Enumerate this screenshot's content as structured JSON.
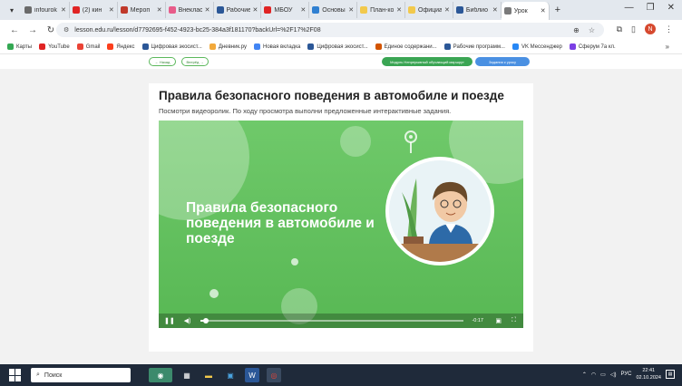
{
  "tabs": [
    {
      "label": "infourok",
      "color": "#6a6a6a"
    },
    {
      "label": "(2) кин",
      "color": "#e02424"
    },
    {
      "label": "Мероп",
      "color": "#c0392b"
    },
    {
      "label": "Внеклас",
      "color": "#e85c8a"
    },
    {
      "label": "Рабочие",
      "color": "#2b5797"
    },
    {
      "label": "МБОУ",
      "color": "#e02424"
    },
    {
      "label": "Основы",
      "color": "#2f7fd1"
    },
    {
      "label": "План-ко",
      "color": "#f2c94c"
    },
    {
      "label": "Официа",
      "color": "#f2c94c"
    },
    {
      "label": "Библио",
      "color": "#2b5797"
    },
    {
      "label": "Урок",
      "color": "#7a7a7a",
      "active": true
    }
  ],
  "address": {
    "url": "lesson.edu.ru/lesson/d7792695-f452-4923-bc25-384a3f181170?backUrl=%2F17%2F08"
  },
  "bookmarks": [
    {
      "label": "Карты",
      "color": "#34a853"
    },
    {
      "label": "YouTube",
      "color": "#e02424"
    },
    {
      "label": "Gmail",
      "color": "#ea4335"
    },
    {
      "label": "Яндекс",
      "color": "#fc3f1d"
    },
    {
      "label": "Цифровая экосист...",
      "color": "#2b5797"
    },
    {
      "label": "Дневник.ру",
      "color": "#f2a93b"
    },
    {
      "label": "Новая вкладка",
      "color": "#4285f4"
    },
    {
      "label": "Цифровая экосист...",
      "color": "#2b5797"
    },
    {
      "label": "Единое содержани...",
      "color": "#d35400"
    },
    {
      "label": "Рабочие программ...",
      "color": "#2b5797"
    },
    {
      "label": "VK Мессенджер",
      "color": "#2787f5"
    },
    {
      "label": "Сферум 7а кл.",
      "color": "#7b3fe4"
    }
  ],
  "lesson_toolbar": {
    "back": "← Назад",
    "forward": "Вперёд →",
    "green_button": "Модуль Непрерывный обучающий маршрут",
    "blue_button": "Задания к уроку"
  },
  "card": {
    "title": "Правила безопасного поведения в автомобиле и поезде",
    "subtitle": "Посмотри видеоролик. По ходу просмотра выполни предложенные интерактивные задания."
  },
  "video": {
    "title": "Правила безопасного поведения в автомобиле и поезде",
    "time": "-0:17",
    "progress": 0.02
  },
  "taskbar": {
    "search_label": "Поиск",
    "lang": "РУС",
    "time": "22:41",
    "date": "02.10.2024"
  },
  "colors": {
    "video_green": "#5bbb57",
    "taskbar": "#1f2a3a"
  }
}
